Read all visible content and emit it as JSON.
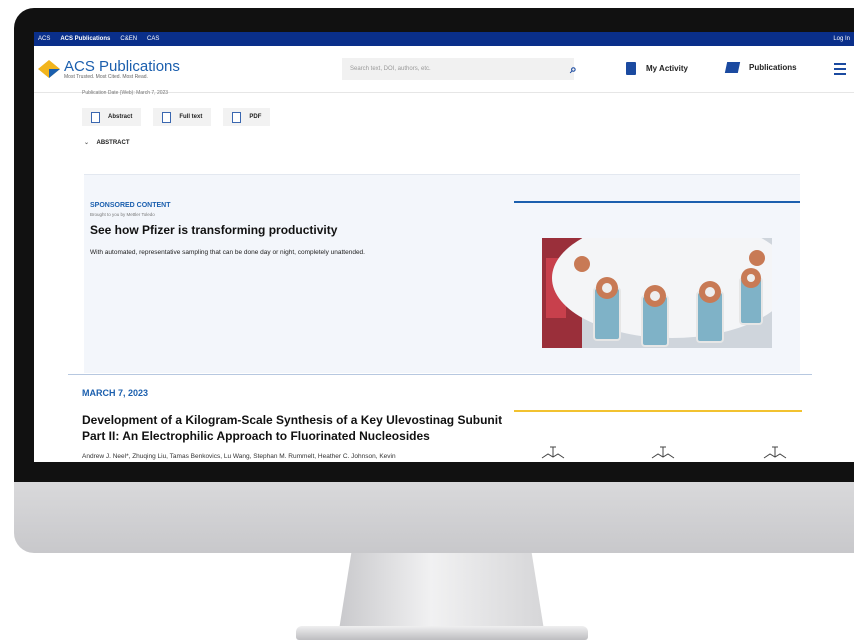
{
  "topbar": {
    "links": [
      "ACS",
      "ACS Publications",
      "C&EN",
      "CAS"
    ],
    "login": "Log In"
  },
  "header": {
    "logo_title": "ACS Publications",
    "logo_tagline": "Most Trusted. Most Cited. Most Read.",
    "search_placeholder": "Search text, DOI, authors, etc.",
    "my_activity": "My Activity",
    "publications": "Publications"
  },
  "article": {
    "publication_date": "Publication Date (Web): March 7, 2023",
    "buttons": [
      "Abstract",
      "Full text",
      "PDF"
    ],
    "abstract_toggle": "ABSTRACT"
  },
  "sponsored": {
    "label": "SPONSORED CONTENT",
    "by": "Brought to you by Mettler Toledo",
    "title": "See how Pfizer is transforming productivity",
    "text": "With automated, representative sampling that can be done day or night, completely unattended.",
    "accent": "#1b5fae"
  },
  "next_article": {
    "date": "MARCH 7, 2023",
    "title": "Development of a Kilogram-Scale Synthesis of a Key Ulevostinag Subunit Part II: An Electrophilic Approach to Fluorinated Nucleosides",
    "authors": "Andrew J. Neel*, Zhuqing Liu, Tamas Benkovics, Lu Wang, Stephan M. Rummelt, Heather C. Johnson, Kevin",
    "accent": "#f2c230"
  },
  "colors": {
    "topbar": "#0a2f8a",
    "brand": "#1b5fae"
  }
}
